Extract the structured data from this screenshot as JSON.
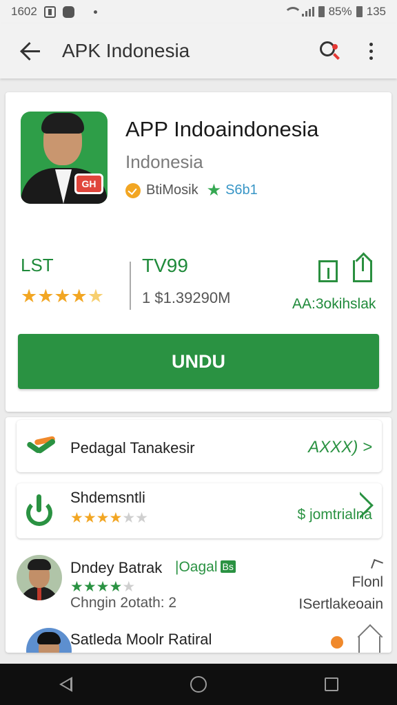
{
  "status_bar": {
    "time": "1602",
    "battery": "85%",
    "clock_right": "135"
  },
  "app_bar": {
    "title": "APK Indonesia"
  },
  "app": {
    "name": "APP Indoaindonesia",
    "developer": "Indonesia",
    "category": "BtiMosik",
    "score": "S6b1",
    "icon_badge": "GH"
  },
  "stats": {
    "left_label": "LST",
    "left_stars": "★★★★",
    "left_stars_half": "★",
    "mid_value": "TV99",
    "mid_size": "1 $1.39290M",
    "action_caption": "AA:3okihslak"
  },
  "install_button": {
    "label": "UNDU"
  },
  "list": {
    "row1": {
      "title": "Pedagal Tanakesir",
      "right": "AXXX) >"
    },
    "row2": {
      "title": "Shdemsntli",
      "stars": "★★★★",
      "stars_dim": "★★",
      "price": "$ jomtrialna"
    },
    "row3": {
      "name": "Dndey Batrak",
      "tag": "|Oagal",
      "badge": "Bs",
      "stars": "★★★★",
      "stars_dim": "★",
      "subtitle": "Chngin 2otath: 2",
      "right_top": "Flonl",
      "right_bottom": "ISertlakeoain"
    },
    "row4": {
      "name": "Satleda Moolr Ratiral"
    }
  },
  "colors": {
    "accent_green": "#2a9242",
    "star_orange": "#f2a623",
    "app_bar_bg": "#f2f2f2",
    "nav_bar_bg": "#0f0f0f"
  },
  "icons": {
    "back": "arrow-left-icon",
    "search": "search-icon",
    "more": "more-vert-icon",
    "install": "install-box-icon",
    "share": "share-icon",
    "nav_back": "triangle-back-icon",
    "nav_home": "circle-home-icon",
    "nav_recent": "square-recent-icon"
  }
}
